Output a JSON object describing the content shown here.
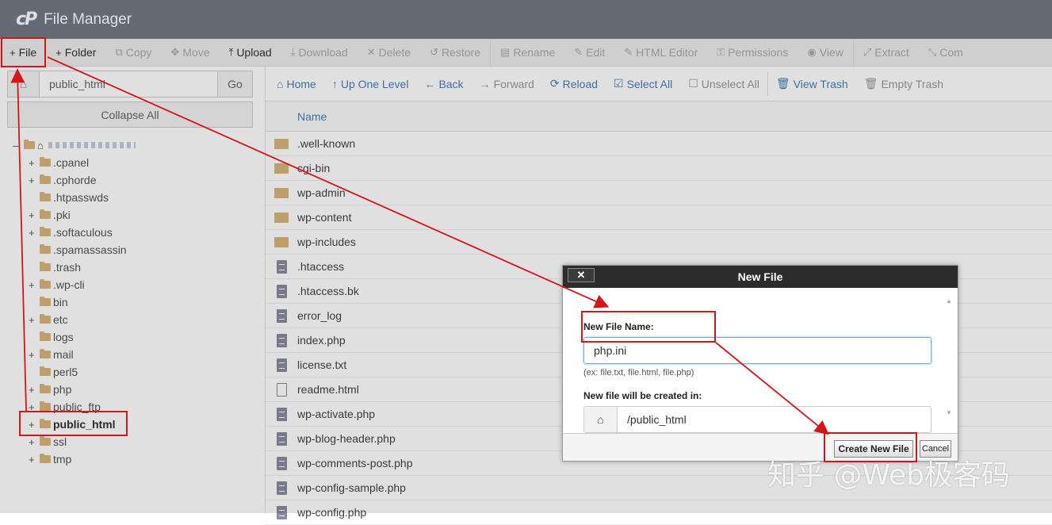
{
  "app": {
    "logo": "cP",
    "title": "File Manager"
  },
  "toolbar": {
    "items": [
      {
        "icon": "+",
        "label": "File",
        "disabled": false
      },
      {
        "icon": "+",
        "label": "Folder",
        "disabled": false
      },
      {
        "icon": "⧉",
        "label": "Copy",
        "disabled": true
      },
      {
        "icon": "✥",
        "label": "Move",
        "disabled": true
      },
      {
        "icon": "⤒",
        "label": "Upload",
        "disabled": false
      },
      {
        "icon": "⤓",
        "label": "Download",
        "disabled": true
      },
      {
        "icon": "✕",
        "label": "Delete",
        "disabled": true
      },
      {
        "icon": "↺",
        "label": "Restore",
        "disabled": true
      },
      {
        "icon": "▤",
        "label": "Rename",
        "disabled": true
      },
      {
        "icon": "✎",
        "label": "Edit",
        "disabled": true
      },
      {
        "icon": "✎",
        "label": "HTML Editor",
        "disabled": true
      },
      {
        "icon": "⚿",
        "label": "Permissions",
        "disabled": true
      },
      {
        "icon": "◉",
        "label": "View",
        "disabled": true
      },
      {
        "icon": "⤢",
        "label": "Extract",
        "disabled": true
      },
      {
        "icon": "⤡",
        "label": "Com",
        "disabled": true
      }
    ]
  },
  "sidebar": {
    "path_value": "public_html",
    "go_label": "Go",
    "collapse_label": "Collapse All",
    "tree": [
      {
        "toggle": "+",
        "label": ".cpanel"
      },
      {
        "toggle": "+",
        "label": ".cphorde"
      },
      {
        "toggle": "",
        "label": ".htpasswds"
      },
      {
        "toggle": "+",
        "label": ".pki"
      },
      {
        "toggle": "+",
        "label": ".softaculous"
      },
      {
        "toggle": "",
        "label": ".spamassassin"
      },
      {
        "toggle": "",
        "label": ".trash"
      },
      {
        "toggle": "+",
        "label": ".wp-cli"
      },
      {
        "toggle": "",
        "label": "bin"
      },
      {
        "toggle": "+",
        "label": "etc"
      },
      {
        "toggle": "",
        "label": "logs"
      },
      {
        "toggle": "+",
        "label": "mail"
      },
      {
        "toggle": "",
        "label": "perl5"
      },
      {
        "toggle": "+",
        "label": "php"
      },
      {
        "toggle": "+",
        "label": "public_ftp"
      },
      {
        "toggle": "+",
        "label": "public_html",
        "selected": true
      },
      {
        "toggle": "+",
        "label": "ssl"
      },
      {
        "toggle": "+",
        "label": "tmp"
      }
    ]
  },
  "navbar": {
    "items": [
      {
        "icon": "⌂",
        "label": "Home",
        "disabled": false
      },
      {
        "icon": "↑",
        "label": "Up One Level",
        "disabled": false
      },
      {
        "icon": "←",
        "label": "Back",
        "disabled": false
      },
      {
        "icon": "→",
        "label": "Forward",
        "disabled": true
      },
      {
        "icon": "⟳",
        "label": "Reload",
        "disabled": false
      },
      {
        "icon": "☑",
        "label": "Select All",
        "disabled": false
      },
      {
        "icon": "☐",
        "label": "Unselect All",
        "disabled": true
      },
      {
        "icon": "🗑",
        "label": "View Trash",
        "disabled": false
      },
      {
        "icon": "🗑",
        "label": "Empty Trash",
        "disabled": true
      }
    ]
  },
  "table": {
    "header": "Name",
    "rows": [
      {
        "type": "folder",
        "name": ".well-known"
      },
      {
        "type": "folder",
        "name": "cgi-bin"
      },
      {
        "type": "folder",
        "name": "wp-admin"
      },
      {
        "type": "folder",
        "name": "wp-content"
      },
      {
        "type": "folder",
        "name": "wp-includes"
      },
      {
        "type": "file",
        "name": ".htaccess"
      },
      {
        "type": "file",
        "name": ".htaccess.bk"
      },
      {
        "type": "file",
        "name": "error_log"
      },
      {
        "type": "file",
        "name": "index.php"
      },
      {
        "type": "file",
        "name": "license.txt"
      },
      {
        "type": "code",
        "name": "readme.html"
      },
      {
        "type": "file",
        "name": "wp-activate.php"
      },
      {
        "type": "file",
        "name": "wp-blog-header.php"
      },
      {
        "type": "file",
        "name": "wp-comments-post.php"
      },
      {
        "type": "file",
        "name": "wp-config-sample.php"
      },
      {
        "type": "file",
        "name": "wp-config.php"
      }
    ]
  },
  "dialog": {
    "title": "New File",
    "close_label": "✕",
    "name_label": "New File Name:",
    "name_value": "php.ini",
    "hint": "(ex: file.txt, file.html, file.php)",
    "location_label": "New file will be created in:",
    "location_value": "/public_html",
    "create_label": "Create New File",
    "cancel_label": "Cancel"
  },
  "watermark": "知乎 @Web极客码",
  "colors": {
    "highlight": "#d4161b",
    "link": "#4a7fb5",
    "topbar": "#737a86"
  }
}
